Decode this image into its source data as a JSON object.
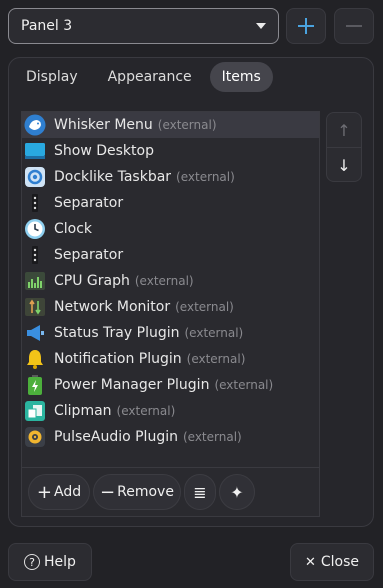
{
  "header": {
    "panel_select_value": "Panel 3",
    "add_panel_icon": "plus-icon",
    "remove_panel_icon": "minus-icon"
  },
  "tabs": [
    {
      "label": "Display"
    },
    {
      "label": "Appearance"
    },
    {
      "label": "Items",
      "active": true
    }
  ],
  "items": [
    {
      "label": "Whisker Menu",
      "suffix": "(external)",
      "icon": "whisker-menu-icon"
    },
    {
      "label": "Show Desktop",
      "suffix": "",
      "icon": "show-desktop-icon"
    },
    {
      "label": "Docklike Taskbar",
      "suffix": "(external)",
      "icon": "docklike-taskbar-icon"
    },
    {
      "label": "Separator",
      "suffix": "",
      "icon": "separator-icon"
    },
    {
      "label": "Clock",
      "suffix": "",
      "icon": "clock-icon"
    },
    {
      "label": "Separator",
      "suffix": "",
      "icon": "separator-icon"
    },
    {
      "label": "CPU Graph",
      "suffix": "(external)",
      "icon": "cpu-graph-icon"
    },
    {
      "label": "Network Monitor",
      "suffix": "(external)",
      "icon": "network-monitor-icon"
    },
    {
      "label": "Status Tray Plugin",
      "suffix": "(external)",
      "icon": "status-tray-icon"
    },
    {
      "label": "Notification Plugin",
      "suffix": "(external)",
      "icon": "notification-bell-icon"
    },
    {
      "label": "Power Manager Plugin",
      "suffix": "(external)",
      "icon": "battery-icon"
    },
    {
      "label": "Clipman",
      "suffix": "(external)",
      "icon": "clipman-icon"
    },
    {
      "label": "PulseAudio Plugin",
      "suffix": "(external)",
      "icon": "speaker-icon"
    }
  ],
  "toolbar": {
    "add_label": "Add",
    "remove_label": "Remove"
  },
  "footer": {
    "help_label": "Help",
    "close_label": "Close"
  },
  "colors": {
    "accent": "#4aa3df",
    "background": "#222226",
    "selected_row": "#3a3a42"
  }
}
